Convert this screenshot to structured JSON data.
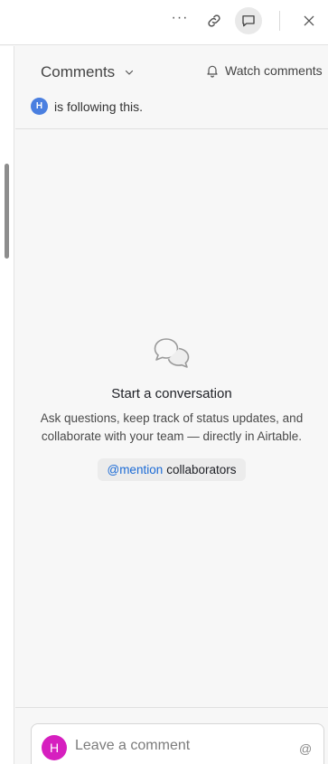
{
  "toolbar": {
    "more_icon": "more-horizontal-icon",
    "more_glyph": "···",
    "link_icon": "link-icon",
    "comments_icon": "comment-bubble-icon",
    "close_icon": "close-icon"
  },
  "panel": {
    "dropdown_label": "Comments",
    "watch_label": "Watch comments",
    "follower_initial": "H",
    "follow_text": "is following this."
  },
  "empty_state": {
    "title": "Start a conversation",
    "description": "Ask questions, keep track of status updates, and collaborate with your team — directly in Airtable.",
    "mention_label": "@mention",
    "mention_suffix": "collaborators"
  },
  "composer": {
    "avatar_initial": "H",
    "placeholder": "Leave a comment",
    "at_label": "@"
  },
  "colors": {
    "accent_blue": "#1c6bd6",
    "follower_avatar": "#4a7fe0",
    "user_avatar": "#d61fbf"
  }
}
